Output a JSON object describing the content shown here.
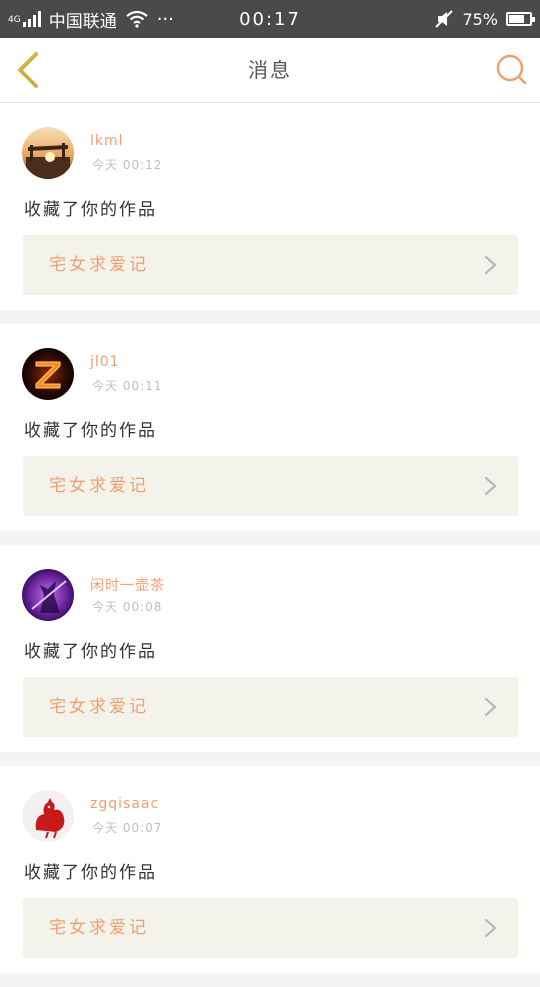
{
  "status_bar": {
    "network": "4G",
    "carrier": "中国联通",
    "more": "···",
    "time": "00:17",
    "battery": "75%",
    "battery_level": 0.75
  },
  "header": {
    "title": "消息",
    "back_icon": "chevron-left-icon",
    "search_icon": "search-icon"
  },
  "colors": {
    "accent": "#f0a070",
    "back_arrow": "#d9b84a",
    "card_bg": "#f3f3ec"
  },
  "messages": [
    {
      "user": "lkml",
      "time": "今天 00:12",
      "action": "收藏了你的作品",
      "work_title": "宅女求爱记",
      "avatar": "sunset-photo"
    },
    {
      "user": "jl01",
      "time": "今天 00:11",
      "action": "收藏了你的作品",
      "work_title": "宅女求爱记",
      "avatar": "fire-letter-z"
    },
    {
      "user": "闲时一壶茶",
      "time": "今天 00:08",
      "action": "收藏了你的作品",
      "work_title": "宅女求爱记",
      "avatar": "purple-warrior"
    },
    {
      "user": "zgqisaac",
      "time": "今天 00:07",
      "action": "收藏了你的作品",
      "work_title": "宅女求爱记",
      "avatar": "red-rooster"
    }
  ]
}
